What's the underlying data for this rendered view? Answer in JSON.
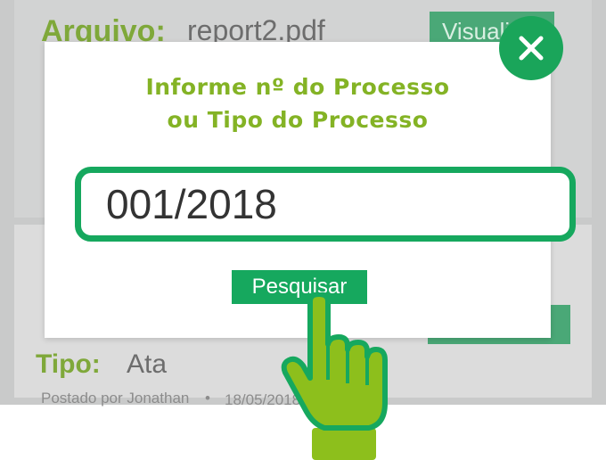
{
  "background": {
    "file_label": "Arquivo:",
    "file_name": "report2.pdf",
    "view_button": "Visualizar",
    "type_label": "Tipo:",
    "type_value": "Ata",
    "posted_by": "Postado por Jonathan",
    "separator": "•",
    "posted_date": "18/05/2018"
  },
  "modal": {
    "title_line1": "Informe nº do Processo",
    "title_line2": "ou Tipo do Processo",
    "input_value": "001/2018",
    "search_button": "Pesquisar"
  },
  "colors": {
    "primary_green": "#16a85e",
    "title_green": "#84b325",
    "hand_green": "#8dbf1c"
  },
  "icons": {
    "close": "close-icon",
    "pointer": "pointing-hand-icon"
  }
}
